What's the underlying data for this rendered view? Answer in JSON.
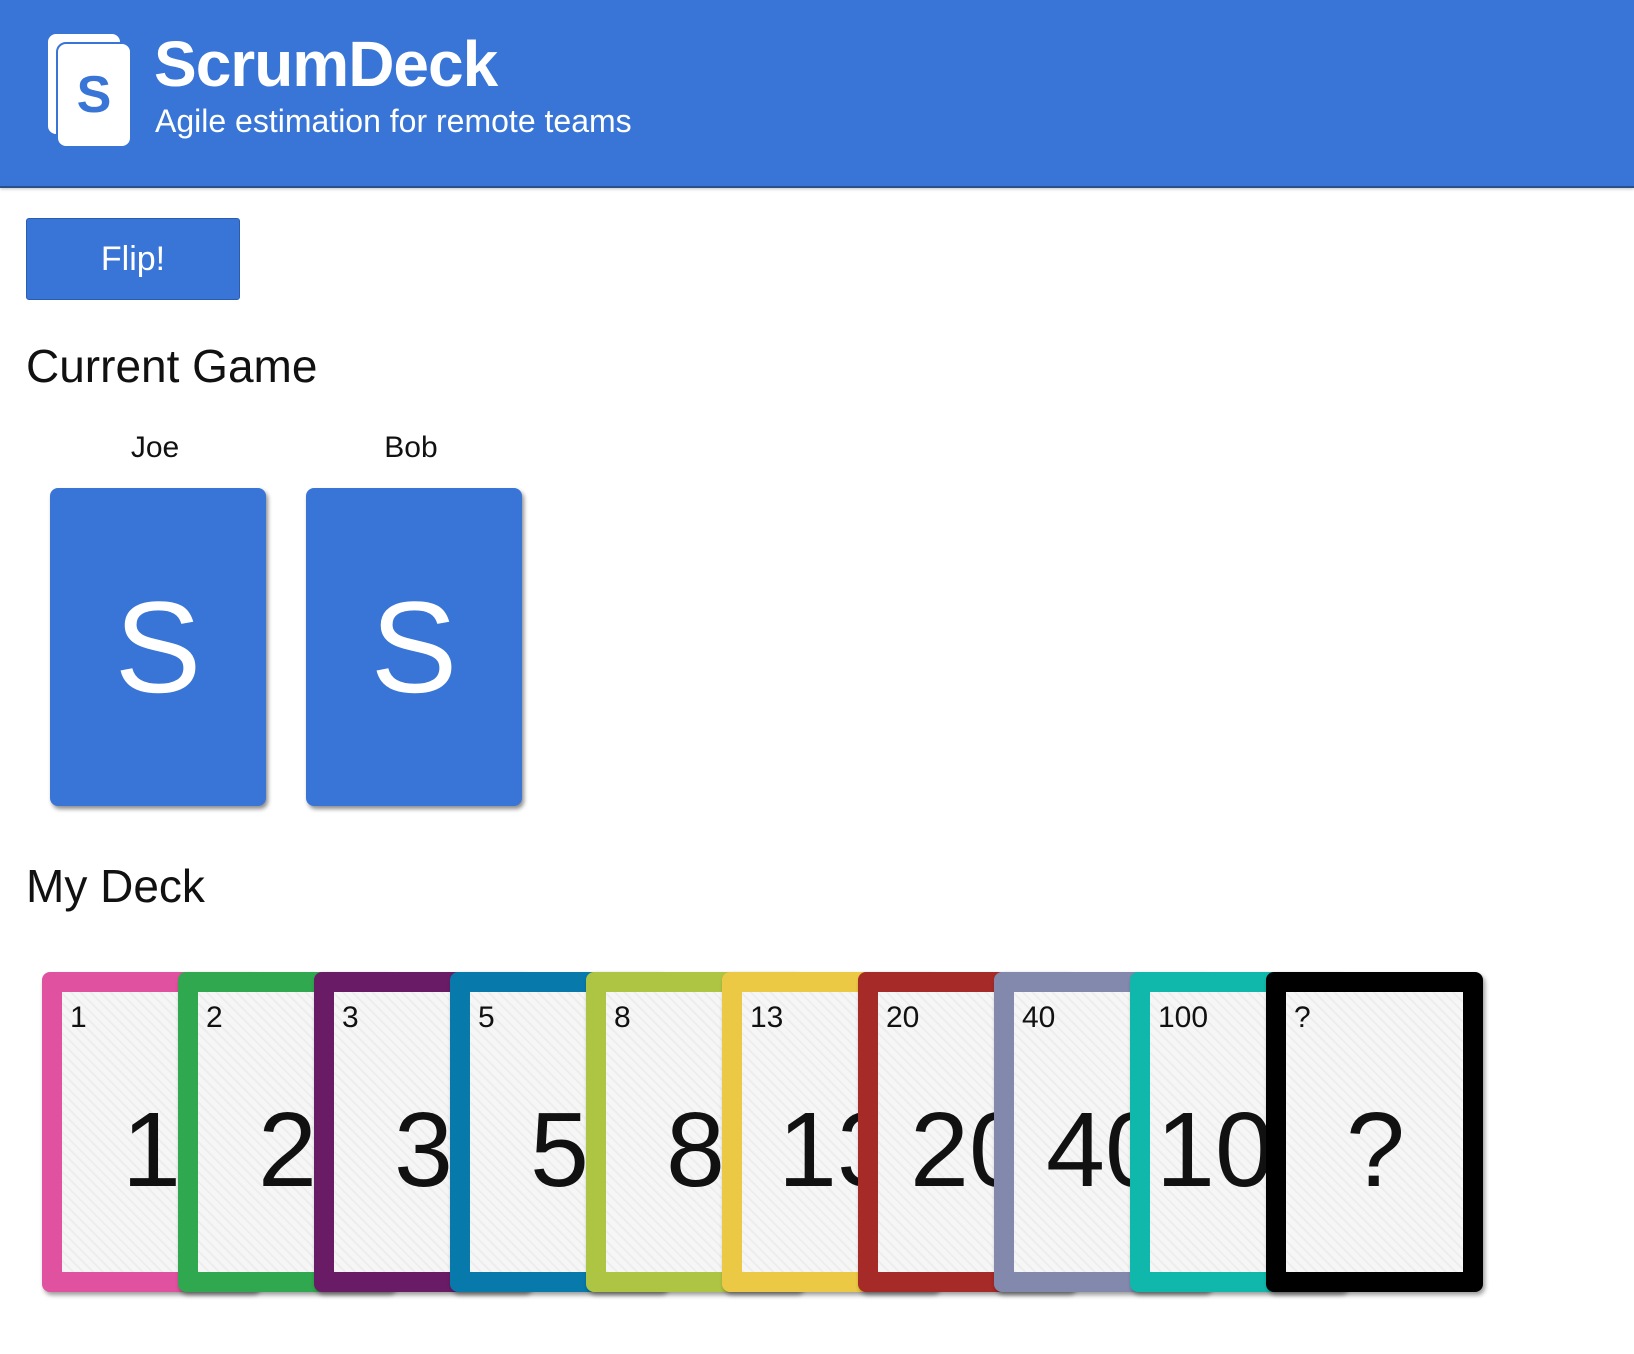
{
  "header": {
    "logo_letter": "S",
    "title": "ScrumDeck",
    "subtitle": "Agile estimation for remote teams",
    "background_color": "#3875d7"
  },
  "actions": {
    "flip_label": "Flip!"
  },
  "current_game": {
    "title": "Current Game",
    "players": [
      {
        "name": "Joe",
        "card_face": "S"
      },
      {
        "name": "Bob",
        "card_face": "S"
      }
    ]
  },
  "my_deck": {
    "title": "My Deck",
    "cards": [
      {
        "value": "1",
        "color": "#e0519f"
      },
      {
        "value": "2",
        "color": "#30a84f"
      },
      {
        "value": "3",
        "color": "#6a1b65"
      },
      {
        "value": "5",
        "color": "#0879ab"
      },
      {
        "value": "8",
        "color": "#aec544"
      },
      {
        "value": "13",
        "color": "#ecc945"
      },
      {
        "value": "20",
        "color": "#a62a27"
      },
      {
        "value": "40",
        "color": "#8289ad"
      },
      {
        "value": "100",
        "color": "#10b8ab"
      },
      {
        "value": "?",
        "color": "#000000"
      }
    ]
  }
}
